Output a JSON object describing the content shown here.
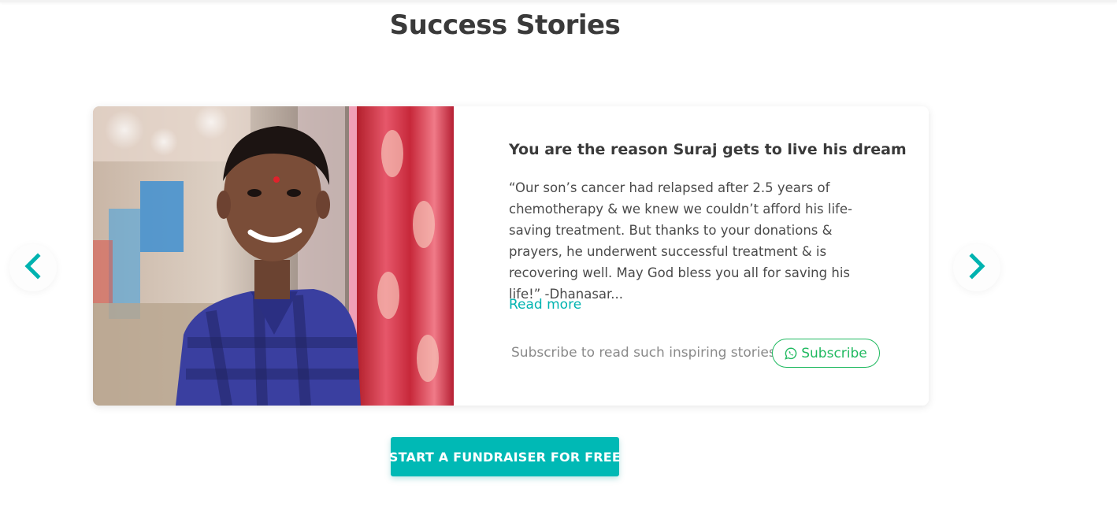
{
  "section": {
    "title": "Success Stories"
  },
  "carousel": {
    "prev_icon": "chevron-left-icon",
    "next_icon": "chevron-right-icon",
    "accent_color": "#00b3b0"
  },
  "story": {
    "title": "You are the reason Suraj gets to live his dream",
    "quote": "“Our son’s cancer had relapsed after 2.5 years of chemotherapy & we knew we couldn’t afford his life-saving treatment. But thanks to your donations & prayers, he underwent successful treatment & is recovering well. May God bless you all for saving his life!” -Dhanasar...",
    "read_more_label": "Read more",
    "photo_icon": "story-photo"
  },
  "subscribe": {
    "prompt": "Subscribe to read such inspiring stories",
    "button_label": "Subscribe",
    "icon": "whatsapp-icon",
    "color": "#20b960"
  },
  "cta": {
    "label": "START A FUNDRAISER FOR FREE",
    "color": "#00b9b5"
  }
}
